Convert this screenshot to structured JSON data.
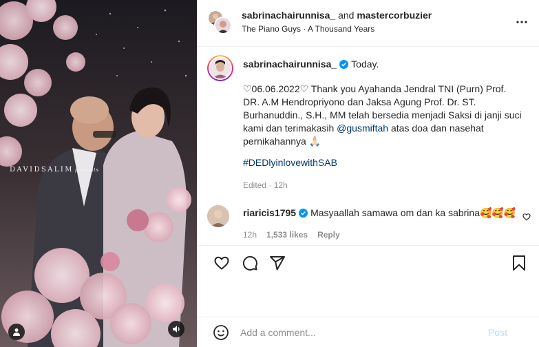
{
  "media": {
    "watermark": "DAVIDSALIM",
    "watermark_suffix": "presents",
    "icons": {
      "user": "person-icon",
      "audio": "speaker-icon"
    }
  },
  "header": {
    "user1": "sabrinachairunnisa_",
    "joiner": "and",
    "user2": "mastercorbuzier",
    "audio": "The Piano Guys · A Thousand Years",
    "more_icon": "more-horizontal-icon"
  },
  "caption": {
    "username": "sabrinachairunnisa_",
    "time": "Today.",
    "text_before_mention": "♡06.06.2022♡ Thank you Ayahanda Jendral TNI (Purn) Prof. DR. A.M Hendropriyono dan Jaksa Agung Prof. Dr. ST. Burhanuddin., S.H., MM telah bersedia menjadi Saksi di janji suci kami dan terimakasih ",
    "mention": "@gusmiftah",
    "text_after_mention": " atas doa dan nasehat pernikahannya 🙏🏻",
    "hashtag": "#DEDlyinlovewithSAB",
    "edited": "Edited · 12h"
  },
  "comment": {
    "username": "riaricis1795",
    "text": "Masyaallah samawa om dan ka sabrina🥰🥰🥰",
    "time": "12h",
    "likes": "1,533 likes",
    "reply": "Reply"
  },
  "actions": {
    "like": "heart-icon",
    "comment": "comment-icon",
    "share": "send-icon",
    "save": "bookmark-icon"
  },
  "add_comment": {
    "placeholder": "Add a comment...",
    "post": "Post"
  },
  "colors": {
    "link": "#00376b",
    "muted": "#8e8e8e",
    "post_disabled": "#b2dffc",
    "verified": "#0095f6"
  }
}
